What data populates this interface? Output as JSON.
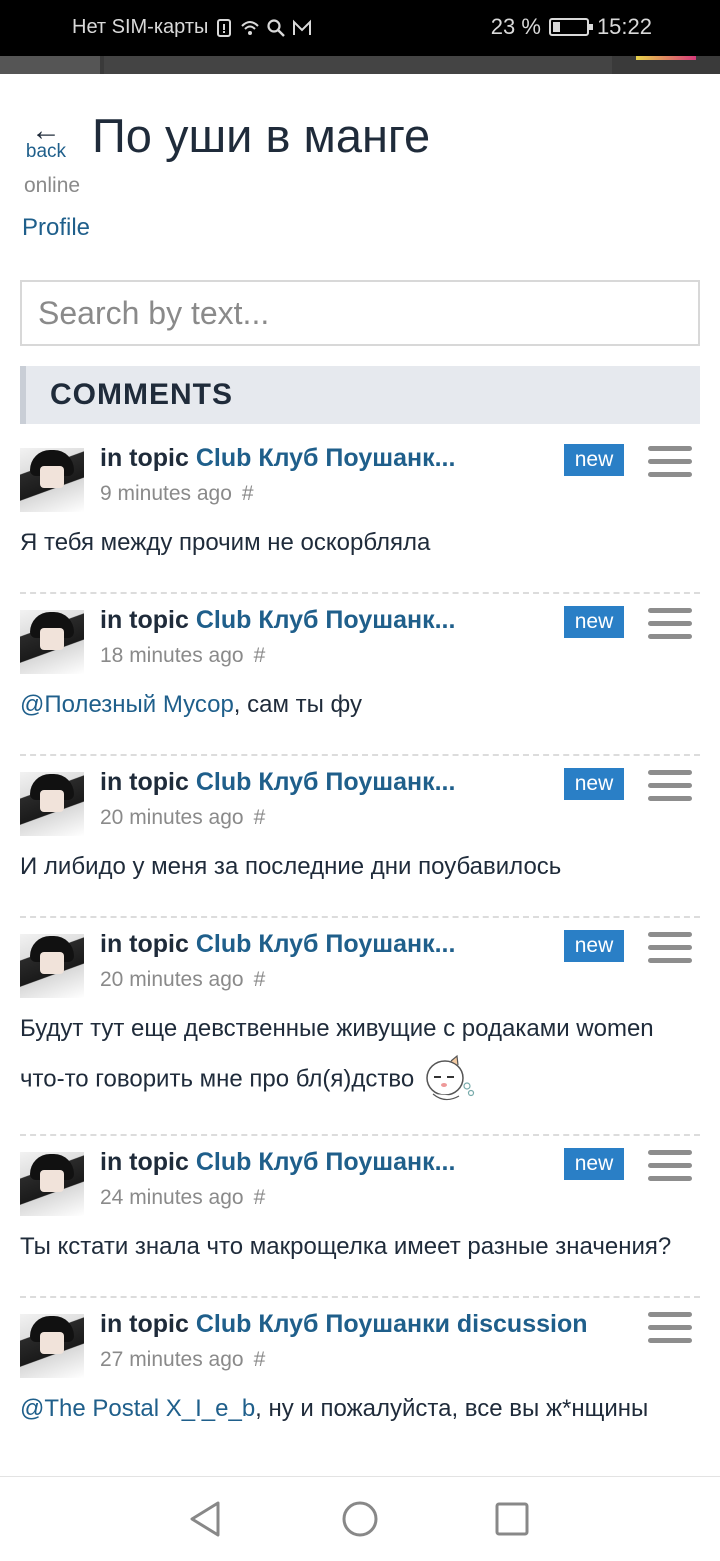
{
  "status_bar": {
    "carrier": "Нет SIM-карты",
    "battery": "23 %",
    "battery_level": 0.23,
    "time": "15:22"
  },
  "header": {
    "back_label": "back",
    "title": "По уши в манге",
    "status": "online",
    "profile_link": "Profile"
  },
  "search": {
    "placeholder": "Search by text..."
  },
  "section_title": "COMMENTS",
  "comments": [
    {
      "prefix": "in topic",
      "topic": "Club Клуб Поушанк...",
      "time": "9 minutes ago",
      "hash": "#",
      "badge": "new",
      "text": "Я тебя между прочим не оскорбляла"
    },
    {
      "prefix": "in topic",
      "topic": "Club Клуб Поушанк...",
      "time": "18 minutes ago",
      "hash": "#",
      "badge": "new",
      "mention": "@Полезный Мусор",
      "text": ", сам ты фу"
    },
    {
      "prefix": "in topic",
      "topic": "Club Клуб Поушанк...",
      "time": "20 minutes ago",
      "hash": "#",
      "badge": "new",
      "text": "И либидо у меня за последние дни поубавилось"
    },
    {
      "prefix": "in topic",
      "topic": "Club Клуб Поушанк...",
      "time": "20 minutes ago",
      "hash": "#",
      "badge": "new",
      "text": "Будут тут еще девственные живущие с родаками women что-то говорить мне про бл(я)дство"
    },
    {
      "prefix": "in topic",
      "topic": "Club Клуб Поушанк...",
      "time": "24 minutes ago",
      "hash": "#",
      "badge": "new",
      "text": "Ты кстати знала что макрощелка имеет разные значения?"
    },
    {
      "prefix": "in topic",
      "topic": "Club Клуб Поушанки discussion",
      "time": "27 minutes ago",
      "hash": "#",
      "mention": "@The Postal X_I_e_b",
      "text": ", ну и пожалуйста, все вы ж*нщины"
    }
  ],
  "colors": {
    "link": "#1f5f8b",
    "badge": "#2a7fc6",
    "text": "#1f2b3a"
  }
}
